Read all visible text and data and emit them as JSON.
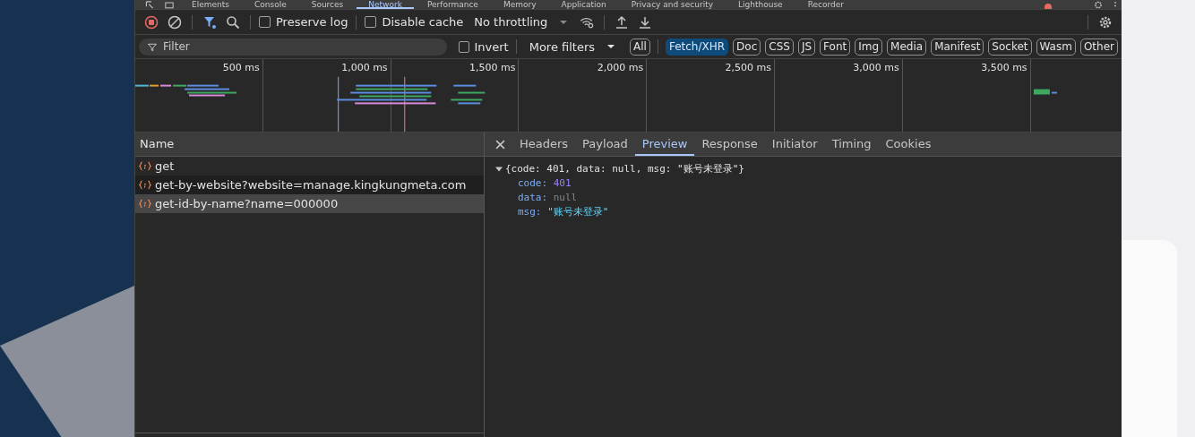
{
  "panel_tabs": [
    {
      "label": "Elements",
      "selected": false
    },
    {
      "label": "Console",
      "selected": false
    },
    {
      "label": "Sources",
      "selected": false
    },
    {
      "label": "Network",
      "selected": true
    },
    {
      "label": "Performance",
      "selected": false
    },
    {
      "label": "Memory",
      "selected": false
    },
    {
      "label": "Application",
      "selected": false
    },
    {
      "label": "Privacy and security",
      "selected": false
    },
    {
      "label": "Lighthouse",
      "selected": false
    },
    {
      "label": "Recorder",
      "selected": false
    }
  ],
  "toolbar": {
    "recording": true,
    "filter_active": true,
    "preserve_log": {
      "label": "Preserve log",
      "checked": false
    },
    "disable_cache": {
      "label": "Disable cache",
      "checked": false
    },
    "throttling": "No throttling"
  },
  "filter_bar": {
    "placeholder": "Filter",
    "invert": {
      "label": "Invert",
      "checked": false
    },
    "more_filters": "More filters",
    "types": [
      {
        "label": "All",
        "selected": false
      },
      {
        "label": "Fetch/XHR",
        "selected": true
      },
      {
        "label": "Doc",
        "selected": false
      },
      {
        "label": "CSS",
        "selected": false
      },
      {
        "label": "JS",
        "selected": false
      },
      {
        "label": "Font",
        "selected": false
      },
      {
        "label": "Img",
        "selected": false
      },
      {
        "label": "Media",
        "selected": false
      },
      {
        "label": "Manifest",
        "selected": false
      },
      {
        "label": "Socket",
        "selected": false
      },
      {
        "label": "Wasm",
        "selected": false
      },
      {
        "label": "Other",
        "selected": false
      }
    ]
  },
  "timeline": {
    "ticks": [
      "500 ms",
      "1,000 ms",
      "1,500 ms",
      "2,000 ms",
      "2,500 ms",
      "3,000 ms",
      "3,500 ms"
    ]
  },
  "requests": {
    "column": "Name",
    "rows": [
      {
        "name": "get",
        "selected": false
      },
      {
        "name": "get-by-website?website=manage.kingkungmeta.com",
        "selected": false
      },
      {
        "name": "get-id-by-name?name=000000",
        "selected": true
      }
    ]
  },
  "detail": {
    "tabs": [
      {
        "label": "Headers",
        "selected": false
      },
      {
        "label": "Payload",
        "selected": false
      },
      {
        "label": "Preview",
        "selected": true
      },
      {
        "label": "Response",
        "selected": false
      },
      {
        "label": "Initiator",
        "selected": false
      },
      {
        "label": "Timing",
        "selected": false
      },
      {
        "label": "Cookies",
        "selected": false
      }
    ],
    "summary": "{code: 401, data: null, msg: \"账号未登录\"}",
    "expanded": true,
    "fields": [
      {
        "key": "code:",
        "value": "401",
        "kind": "number"
      },
      {
        "key": "data:",
        "value": "null",
        "kind": "null"
      },
      {
        "key": "msg:",
        "value": "\"账号未登录\"",
        "kind": "string"
      }
    ]
  }
}
